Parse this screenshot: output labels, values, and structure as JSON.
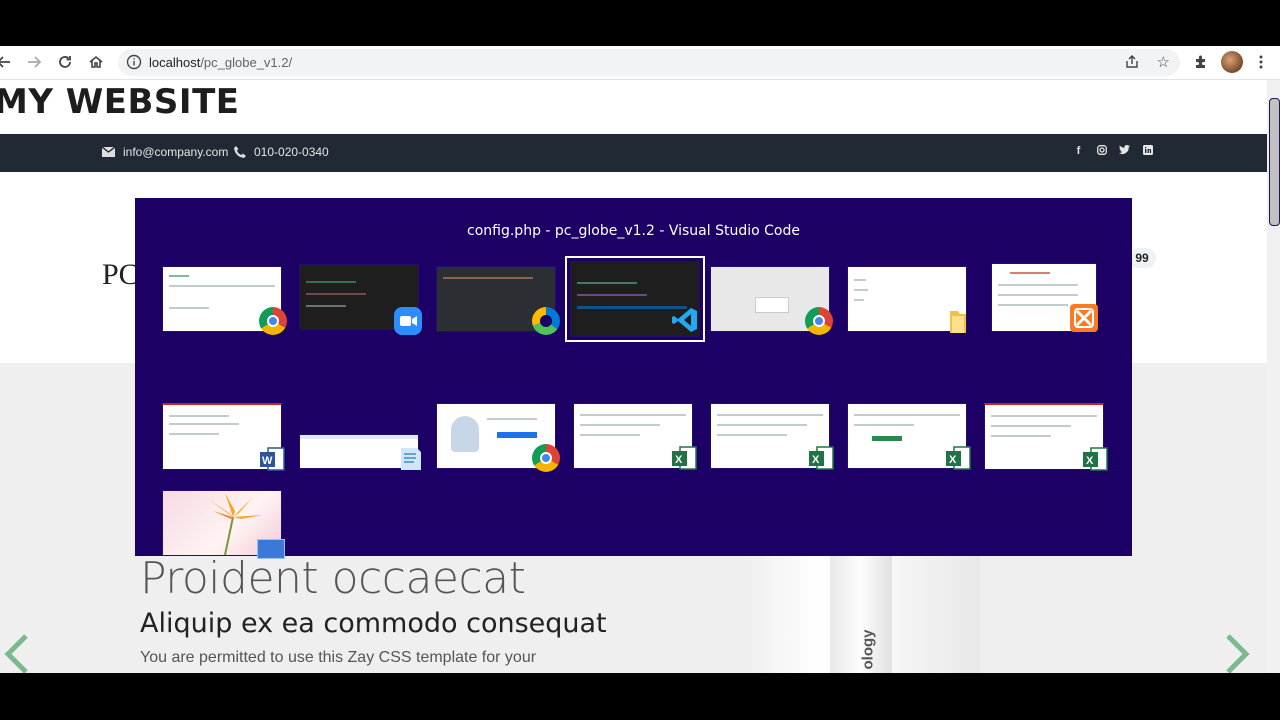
{
  "browser": {
    "url_host": "localhost",
    "url_path": "/pc_globe_v1.2/"
  },
  "website": {
    "title": "MY WEBSITE",
    "email": "info@company.com",
    "phone": "010-020-0340",
    "logo_fragment": "PC",
    "badge_fragment": "99",
    "hero_heading": "Proident occaecat",
    "hero_subheading": "Aliquip ex ea commodo consequat",
    "hero_text": "You are permitted to use this Zay CSS template for your",
    "product_label": "ology",
    "socials": [
      "f",
      "ig",
      "tw",
      "in"
    ]
  },
  "switcher": {
    "title": "config.php - pc_globe_v1.2 - Visual Studio Code",
    "windows": [
      {
        "app": "chrome",
        "theme": "light"
      },
      {
        "app": "zoom",
        "theme": "dark"
      },
      {
        "app": "edge",
        "theme": "dark"
      },
      {
        "app": "vscode",
        "theme": "dark",
        "selected": true
      },
      {
        "app": "chrome",
        "theme": "gray"
      },
      {
        "app": "explorer",
        "theme": "light"
      },
      {
        "app": "xampp",
        "theme": "light"
      },
      {
        "app": "word",
        "theme": "light"
      },
      {
        "app": "notepad",
        "theme": "light"
      },
      {
        "app": "chrome",
        "theme": "light"
      },
      {
        "app": "excel",
        "theme": "light"
      },
      {
        "app": "excel",
        "theme": "light"
      },
      {
        "app": "excel",
        "theme": "light"
      },
      {
        "app": "excel",
        "theme": "light"
      },
      {
        "app": "photos",
        "theme": "flower"
      }
    ]
  }
}
